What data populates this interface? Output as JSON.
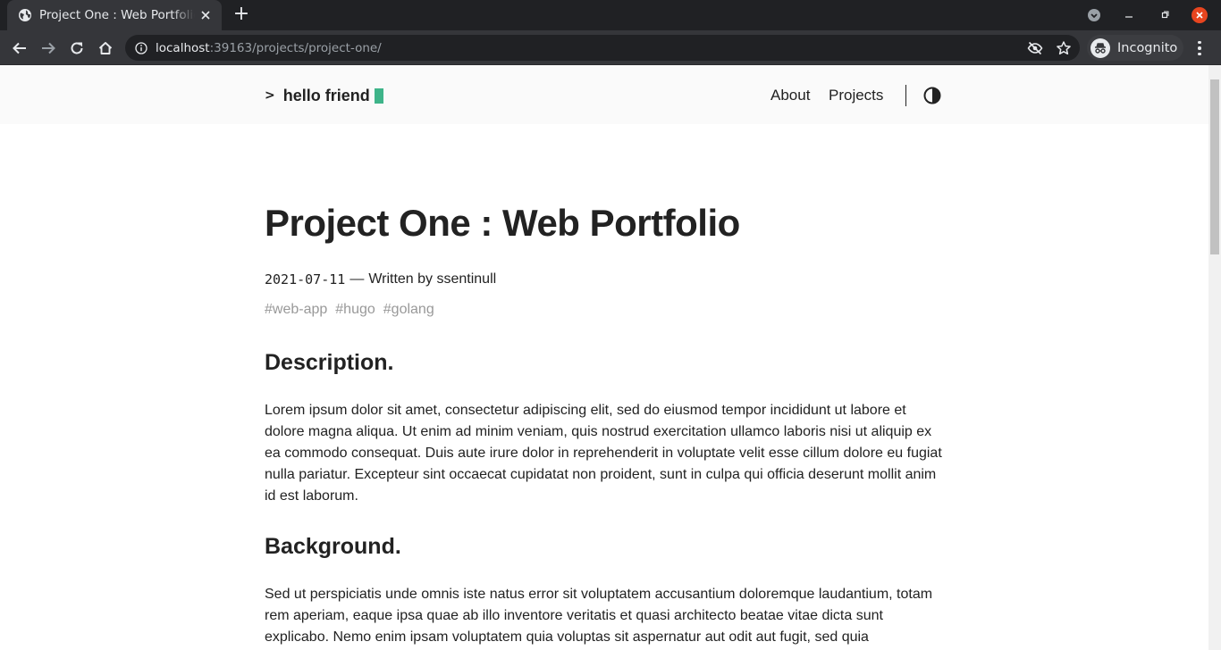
{
  "browser": {
    "tab_title": "Project One : Web Portfolio",
    "new_tab_label": "+",
    "url_host": "localhost",
    "url_rest": ":39163/projects/project-one/",
    "profile_label": "Incognito"
  },
  "header": {
    "logo_prompt": ">",
    "logo_text": "hello friend",
    "accent_color": "#3eb489",
    "menu": {
      "about": "About",
      "projects": "Projects"
    }
  },
  "post": {
    "title": "Project One : Web Portfolio",
    "date": "2021-07-11",
    "separator": "—",
    "author_line": "Written by ssentinull",
    "tags": [
      "#web-app",
      "#hugo",
      "#golang"
    ],
    "sections": {
      "description_heading": "Description.",
      "description_text": "Lorem ipsum dolor sit amet, consectetur adipiscing elit, sed do eiusmod tempor incididunt ut labore et dolore magna aliqua. Ut enim ad minim veniam, quis nostrud exercitation ullamco laboris nisi ut aliquip ex ea commodo consequat. Duis aute irure dolor in reprehenderit in voluptate velit esse cillum dolore eu fugiat nulla pariatur. Excepteur sint occaecat cupidatat non proident, sunt in culpa qui officia deserunt mollit anim id est laborum.",
      "background_heading": "Background.",
      "background_text": "Sed ut perspiciatis unde omnis iste natus error sit voluptatem accusantium doloremque laudantium, totam rem aperiam, eaque ipsa quae ab illo inventore veritatis et quasi architecto beatae vitae dicta sunt explicabo. Nemo enim ipsam voluptatem quia voluptas sit aspernatur aut odit aut fugit, sed quia consequuntur magni dolores eos qui ratione voluptatem sequi nesciunt. Neque porro quisquam est,"
    }
  }
}
